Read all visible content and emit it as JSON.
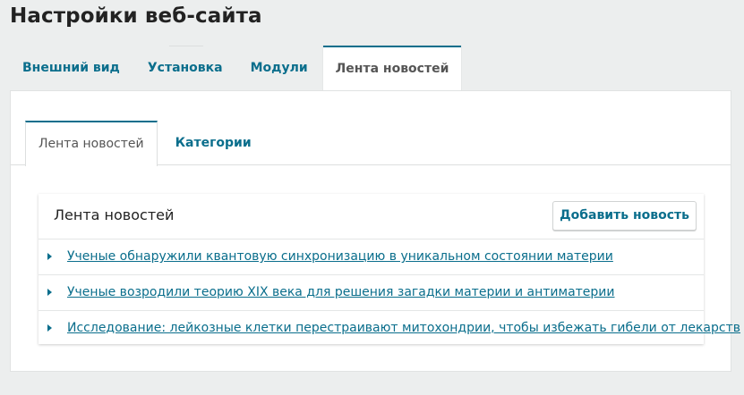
{
  "page": {
    "title": "Настройки веб-сайта"
  },
  "outer_tabs": [
    {
      "label": "Внешний вид",
      "active": false
    },
    {
      "label": "Установка",
      "active": false
    },
    {
      "label": "Модули",
      "active": false
    },
    {
      "label": "Лента новостей",
      "active": true
    }
  ],
  "inner_tabs": [
    {
      "label": "Лента новостей",
      "active": true
    },
    {
      "label": "Категории",
      "active": false
    }
  ],
  "news_panel": {
    "title": "Лента новостей",
    "add_button_label": "Добавить новость",
    "items": [
      {
        "title": "Ученые обнаружили квантовую синхронизацию в уникальном состоянии материи"
      },
      {
        "title": "Ученые возродили теорию XIX века для решения загадки материи и антиматерии"
      },
      {
        "title": "Исследование: лейкозные клетки перестраивают митохондрии, чтобы избежать гибели от лекарств"
      }
    ]
  },
  "colors": {
    "background": "#eceeee",
    "accent": "#0a6e8c",
    "panel": "#ffffff",
    "active_tab_text": "#555555"
  },
  "icons": {
    "list_item_expand": "caret-right-icon"
  }
}
